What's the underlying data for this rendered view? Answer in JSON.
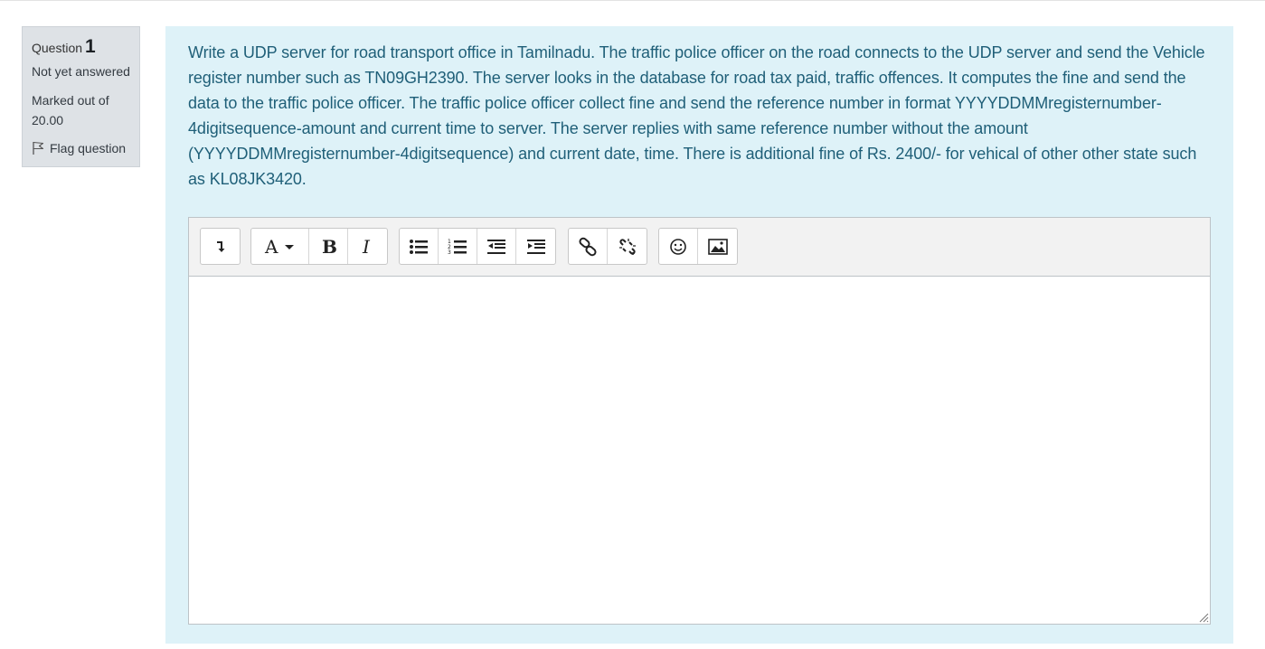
{
  "info": {
    "question_label": "Question",
    "question_number": "1",
    "state": "Not yet answered",
    "grade": "Marked out of 20.00",
    "flag_label": "Flag question"
  },
  "question": {
    "text": "Write a UDP server for road transport office in Tamilnadu. The traffic police officer on the road connects to the UDP server and send the Vehicle register number such as TN09GH2390. The server looks in the database for road tax paid, traffic offences. It computes the fine and send the data to the traffic police officer. The traffic police officer collect fine and send the reference number in format YYYYDDMMregisternumber-4digitsequence-amount and current time to server. The server replies with same reference number without the amount (YYYYDDMMregisternumber-4digitsequence) and current date, time. There is additional fine of Rs. 2400/- for vehical of other other state such as KL08JK3420."
  },
  "editor": {
    "toolbar_groups": [
      [
        "show-more-buttons-icon"
      ],
      [
        "font-style-icon",
        "bold-icon",
        "italic-icon"
      ],
      [
        "unordered-list-icon",
        "ordered-list-icon",
        "outdent-icon",
        "indent-icon"
      ],
      [
        "link-icon",
        "unlink-icon"
      ],
      [
        "emoticon-icon",
        "image-icon"
      ]
    ],
    "answer_value": ""
  },
  "colors": {
    "info_bg": "#dee2e6",
    "content_bg": "#def2f8",
    "question_text": "#1f5f78",
    "toolbar_bg": "#f2f2f2"
  }
}
